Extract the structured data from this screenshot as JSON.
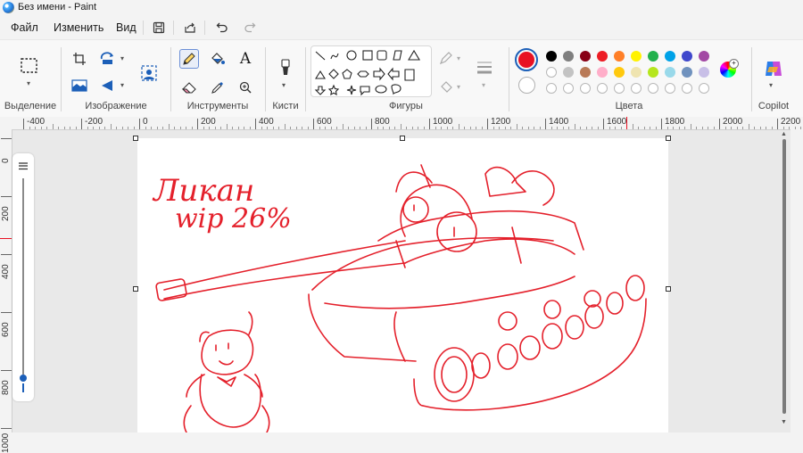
{
  "window": {
    "title": "Без имени - Paint"
  },
  "menu": {
    "file": "Файл",
    "edit": "Изменить",
    "view": "Вид"
  },
  "ribbon": {
    "groups": {
      "selection": "Выделение",
      "image": "Изображение",
      "tools": "Инструменты",
      "brushes": "Кисти",
      "shapes": "Фигуры",
      "colors": "Цвета",
      "copilot": "Copilot"
    },
    "text_tool": "A"
  },
  "colors": {
    "primary": "#e81123",
    "secondary": "#ffffff",
    "palette_row1": [
      "#000000",
      "#7f7f7f",
      "#880015",
      "#ed1c24",
      "#ff7f27",
      "#fff200",
      "#22b14c",
      "#00a2e8",
      "#3f48cc",
      "#a349a4"
    ],
    "palette_row2": [
      "#ffffff",
      "#c3c3c3",
      "#b97a57",
      "#ffaec9",
      "#ffc90e",
      "#efe4b0",
      "#b5e61d",
      "#99d9ea",
      "#7092be",
      "#c8bfe7"
    ]
  },
  "ruler": {
    "h_labels": [
      "-400",
      "-200",
      "0",
      "200",
      "400",
      "600",
      "800",
      "1000",
      "1200",
      "1400",
      "1600",
      "1800",
      "2000",
      "2200"
    ],
    "v_labels": [
      "0",
      "200",
      "400",
      "600",
      "800",
      "1000"
    ]
  },
  "drawing": {
    "caption_line1": "Ликан",
    "caption_line2": "wip 26%",
    "stroke_color": "#e4202b"
  }
}
